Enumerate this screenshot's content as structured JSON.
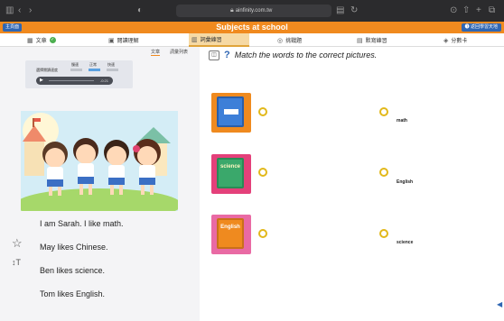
{
  "browser": {
    "url": "ainfinity.com.tw",
    "icons": [
      "sidebar-icon",
      "back-icon",
      "forward-icon",
      "shield-icon",
      "lock-icon",
      "reader-icon",
      "refresh-icon",
      "download-icon",
      "share-icon",
      "new-tab-icon",
      "tabs-icon"
    ]
  },
  "header": {
    "title": "Subjects at school",
    "home_label": "主頁面",
    "back_label": "❶ 返回學習天地"
  },
  "tabs": [
    {
      "label": "文章",
      "icon": "book-icon",
      "done": true
    },
    {
      "label": "閱讀理解",
      "icon": "reading-icon"
    },
    {
      "label": "詞彙練習",
      "icon": "vocabulary-icon",
      "active": true
    },
    {
      "label": "挑戰題",
      "icon": "challenge-icon"
    },
    {
      "label": "默寫練習",
      "icon": "writing-icon"
    },
    {
      "label": "分數卡",
      "icon": "score-icon"
    }
  ],
  "left": {
    "text_tab": "文章",
    "vocab_tab": "詞彙列表",
    "speed_label": "選擇閱讀速度",
    "speeds": [
      "慢速",
      "正常",
      "快速"
    ],
    "selected_speed": "正常",
    "time": "-0:21",
    "story": [
      "I am Sarah. I like math.",
      "May likes Chinese.",
      "Ben likes science.",
      "Tom likes English."
    ]
  },
  "exercise": {
    "instruction": "Match the words to the correct pictures.",
    "pictures": [
      {
        "name": "math-book",
        "label": "",
        "color": "#3d7fd8",
        "frame": "#ef8a1f"
      },
      {
        "name": "science-book",
        "label": "science",
        "color": "#3aa86b",
        "frame": "#e4407a"
      },
      {
        "name": "english-book",
        "label": "English",
        "color": "#ef8a1f",
        "frame": "#e96aa4"
      }
    ],
    "words": [
      "math",
      "English",
      "science"
    ]
  },
  "colors": {
    "header": "#f08a1f",
    "accent_blue": "#2f66b3",
    "dot": "#e2b81a"
  }
}
